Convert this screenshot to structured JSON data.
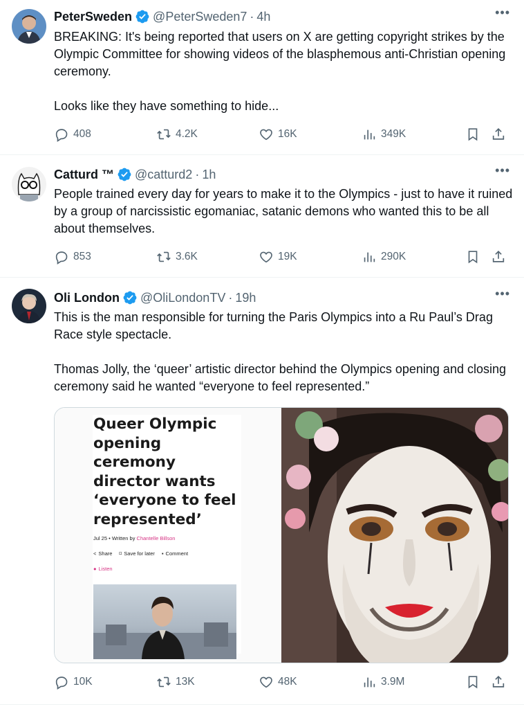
{
  "tweets": [
    {
      "name": "PeterSweden",
      "handle": "@PeterSweden7",
      "time": "4h",
      "text": "BREAKING: It's being reported that users on X are getting copyright strikes by the Olympic Committee for showing videos of the blasphemous anti-Christian opening ceremony.\n\nLooks like they have something to hide...",
      "replies": "408",
      "reposts": "4.2K",
      "likes": "16K",
      "views": "349K"
    },
    {
      "name": "Catturd ™",
      "handle": "@catturd2",
      "time": "1h",
      "text": "People trained every day for years to make it to the Olympics - just to have it ruined by a group of narcissistic egomaniac, satanic demons who wanted this to be all about themselves.",
      "replies": "853",
      "reposts": "3.6K",
      "likes": "19K",
      "views": "290K"
    },
    {
      "name": "Oli London",
      "handle": "@OliLondonTV",
      "time": "19h",
      "text": "This is the man responsible for turning  the Paris Olympics into a Ru Paul’s Drag Race style spectacle.\n\nThomas Jolly, the ‘queer’ artistic director behind the Olympics opening and closing ceremony said he wanted “everyone to feel represented.”",
      "replies": "10K",
      "reposts": "13K",
      "likes": "48K",
      "views": "3.9M",
      "article": {
        "headline": "Queer Olympic opening ceremony director wants ‘everyone to feel represented’",
        "date": "Jul 25 •",
        "written_by": "Written by",
        "author": "Chantelle Billson",
        "share": "Share",
        "save": "Save for later",
        "comment": "Comment",
        "listen": "Listen"
      }
    }
  ],
  "colors": {
    "verified": "#1d9bf0",
    "secondary_text": "#536471",
    "divider": "#eff3f4",
    "article_accent": "#d63384"
  },
  "icons": [
    "verified-badge-icon",
    "more-icon",
    "reply-icon",
    "repost-icon",
    "like-icon",
    "views-icon",
    "bookmark-icon",
    "share-icon"
  ]
}
